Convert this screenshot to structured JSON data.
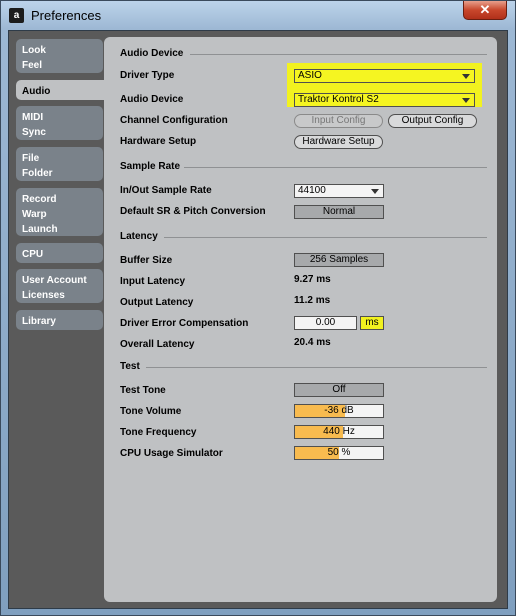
{
  "window": {
    "title": "Preferences",
    "close_glyph": "✕",
    "icon_glyph": "a"
  },
  "tabs": [
    {
      "lines": [
        "Look",
        "Feel"
      ]
    },
    {
      "lines": [
        "Audio"
      ]
    },
    {
      "lines": [
        "MIDI",
        "Sync"
      ]
    },
    {
      "lines": [
        "File",
        "Folder"
      ]
    },
    {
      "lines": [
        "Record",
        "Warp",
        "Launch"
      ]
    },
    {
      "lines": [
        "CPU"
      ]
    },
    {
      "lines": [
        "User Account",
        "Licenses"
      ]
    },
    {
      "lines": [
        "Library"
      ]
    }
  ],
  "audio_device": {
    "heading": "Audio Device",
    "driver_type_label": "Driver Type",
    "driver_type_value": "ASIO",
    "audio_device_label": "Audio Device",
    "audio_device_value": "Traktor Kontrol S2",
    "channel_config_label": "Channel Configuration",
    "input_config_button": "Input Config",
    "output_config_button": "Output Config",
    "hardware_setup_label": "Hardware Setup",
    "hardware_setup_button": "Hardware Setup"
  },
  "sample_rate": {
    "heading": "Sample Rate",
    "in_out_label": "In/Out Sample Rate",
    "in_out_value": "44100",
    "default_sr_label": "Default SR & Pitch Conversion",
    "default_sr_value": "Normal"
  },
  "latency": {
    "heading": "Latency",
    "buffer_label": "Buffer Size",
    "buffer_value": "256 Samples",
    "input_latency_label": "Input Latency",
    "input_latency_value": "9.27 ms",
    "output_latency_label": "Output Latency",
    "output_latency_value": "11.2 ms",
    "driver_error_label": "Driver Error Compensation",
    "driver_error_value": "0.00",
    "driver_error_unit": "ms",
    "overall_label": "Overall Latency",
    "overall_value": "20.4 ms"
  },
  "test": {
    "heading": "Test",
    "tone_label": "Test Tone",
    "tone_value": "Off",
    "volume_label": "Tone Volume",
    "volume_value": "-36 dB",
    "volume_fill": 0.57,
    "freq_label": "Tone Frequency",
    "freq_value": "440 Hz",
    "freq_fill": 0.55,
    "cpu_label": "CPU Usage Simulator",
    "cpu_value": "50 %",
    "cpu_fill": 0.5
  },
  "colors": {
    "highlight": "#f2f21f",
    "slider_fill": "#f8bb4f",
    "panel": "#bfc1c3"
  }
}
